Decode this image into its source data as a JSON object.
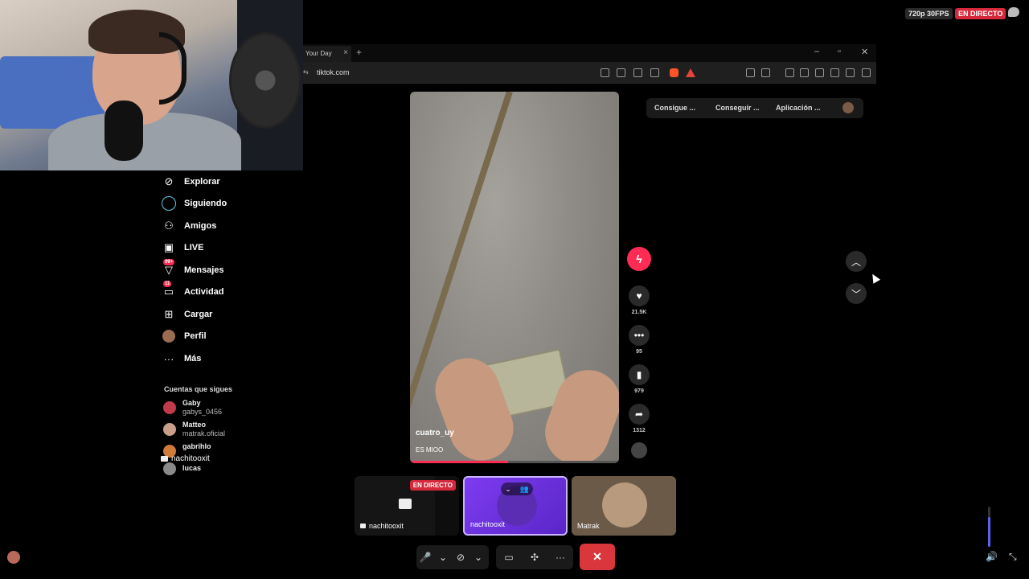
{
  "stream": {
    "quality_badge": "720p 30FPS",
    "live_badge": "EN DIRECTO"
  },
  "browser": {
    "tab_title": "Your Day",
    "tab_close": "×",
    "new_tab": "+",
    "url": "tiktok.com",
    "window_controls": [
      "–",
      "▫",
      "✕"
    ],
    "extensions": [
      "Consigue ...",
      "Conseguir ...",
      "Aplicación ..."
    ]
  },
  "sidebar": {
    "items": [
      {
        "label": "Explorar",
        "icon": "compass-icon",
        "glyph": "◎"
      },
      {
        "label": "Siguiendo",
        "icon": "following-icon",
        "glyph": ""
      },
      {
        "label": "Amigos",
        "icon": "friends-icon",
        "glyph": "👥"
      },
      {
        "label": "LIVE",
        "icon": "live-tv-icon",
        "glyph": "📺"
      },
      {
        "label": "Mensajes",
        "icon": "messages-icon",
        "glyph": "✉",
        "badge": "99+"
      },
      {
        "label": "Actividad",
        "icon": "activity-icon",
        "glyph": "✉",
        "badge": "11"
      },
      {
        "label": "Cargar",
        "icon": "upload-icon",
        "glyph": "⊞"
      },
      {
        "label": "Perfil",
        "icon": "profile-icon",
        "glyph": ""
      },
      {
        "label": "Más",
        "icon": "more-icon",
        "glyph": "···"
      }
    ],
    "following_header": "Cuentas que sigues",
    "following": [
      {
        "name": "Gaby",
        "handle": "gabys_0456",
        "color": "#c23b4a"
      },
      {
        "name": "Matteo",
        "handle": "matrak.oficial",
        "color": "#c8a08a"
      },
      {
        "name": "gabrihlo",
        "handle": "",
        "color": "#d07b3c"
      },
      {
        "name": "lucas",
        "handle": "",
        "color": "#8a8a8a"
      }
    ]
  },
  "cam_label": "nachitooxit",
  "video": {
    "username": "cuatro_uy",
    "caption": "ES MIOO",
    "progress": 0.47
  },
  "actions": {
    "likes": "21.5K",
    "comments": "95",
    "saves": "979",
    "shares": "1312"
  },
  "tiles": [
    {
      "name": "nachitooxit",
      "live": "EN DIRECTO"
    },
    {
      "name": "nachitooxit"
    },
    {
      "name": "Matrak"
    }
  ],
  "volume_level": 0.75,
  "colors": {
    "tiktok_red": "#fe2c55",
    "live_red": "#d6283a",
    "discord_blurple": "#5865f2",
    "hangup_red": "#da373c"
  }
}
